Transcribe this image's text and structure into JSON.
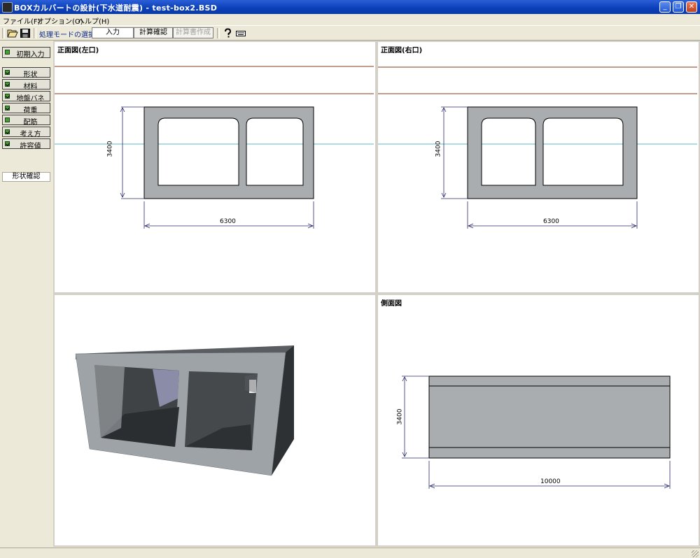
{
  "window": {
    "title": "BOXカルバートの設計(下水道耐震) - test-box2.BSD",
    "minimize_glyph": "_",
    "restore_glyph": "❐",
    "close_glyph": "✕"
  },
  "menu": [
    {
      "label": "ファイル(F)"
    },
    {
      "label": "オプション(O)"
    },
    {
      "label": "ヘルプ(H)"
    }
  ],
  "toolbar": {
    "open_icon": "folder-open-icon",
    "save_icon": "floppy-save-icon",
    "mode_label": "処理モードの選択",
    "input_button": "入力",
    "calc_check_button": "計算確認",
    "report_button": "計算書作成",
    "help_icon": "help-question-icon",
    "keyboard_icon": "keyboard-icon"
  },
  "sidebar": {
    "initial_input": "初期入力",
    "items": [
      {
        "label": "形状",
        "checked": true
      },
      {
        "label": "材料",
        "checked": true
      },
      {
        "label": "地盤バネ",
        "checked": true
      },
      {
        "label": "荷重",
        "checked": true
      },
      {
        "label": "配筋",
        "checked": false
      },
      {
        "label": "考え方",
        "checked": true
      },
      {
        "label": "許容値",
        "checked": true
      }
    ],
    "shape_confirm": "形状確認"
  },
  "panes": {
    "front_left": {
      "title": "正面図(左口)",
      "dim_height": "3400",
      "dim_width": "6300"
    },
    "front_right": {
      "title": "正面図(右口)",
      "dim_height": "3400",
      "dim_width": "6300"
    },
    "side": {
      "title": "側面図",
      "dim_height": "3400",
      "dim_length": "10000"
    }
  },
  "colors": {
    "concrete": "#a9adb0",
    "soil_line": "#8b3a1a",
    "water_line": "#5bb8c8",
    "dim_line": "#2a2a6a",
    "indicator": "#4a9a3a"
  }
}
